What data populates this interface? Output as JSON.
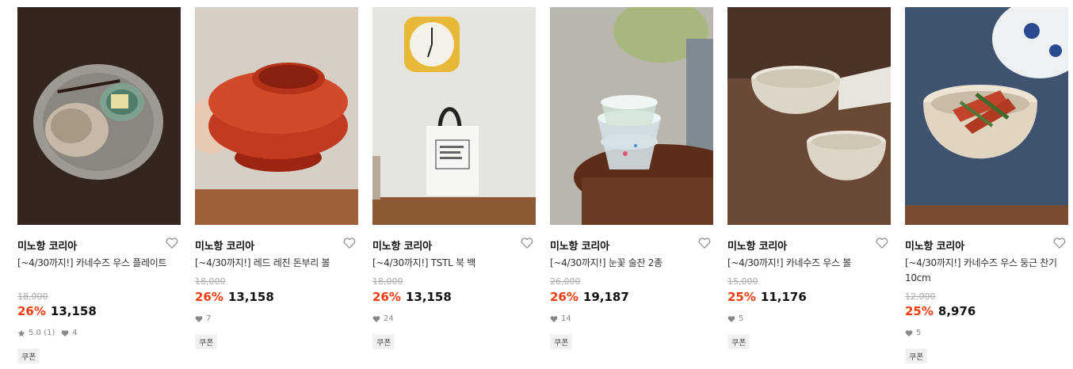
{
  "coupon_label": "쿠폰",
  "products": [
    {
      "brand": "미노항 코리아",
      "title": "[~4/30까지!] 카네수즈 우스 플레이트",
      "original_price": "18,000",
      "discount": "26%",
      "price": "13,158",
      "rating": "5.0 (1)",
      "likes": "4",
      "image": "plate-with-bread",
      "heart_icon": "heart-outline-icon"
    },
    {
      "brand": "미노항 코리아",
      "title": "[~4/30까지!] 레드 레진 돈부리 볼",
      "original_price": "18,000",
      "discount": "26%",
      "price": "13,158",
      "likes": "7",
      "image": "red-lacquer-bowl",
      "heart_icon": "heart-outline-icon"
    },
    {
      "brand": "미노항 코리아",
      "title": "[~4/30까지!] TSTL 북 백",
      "original_price": "18,000",
      "discount": "26%",
      "price": "13,158",
      "likes": "24",
      "image": "tote-bag-with-clock",
      "heart_icon": "heart-outline-icon"
    },
    {
      "brand": "미노항 코리아",
      "title": "[~4/30까지!] 눈꽃 술잔 2종",
      "original_price": "26,000",
      "discount": "26%",
      "price": "19,187",
      "likes": "14",
      "image": "glass-cups",
      "heart_icon": "heart-outline-icon"
    },
    {
      "brand": "미노항 코리아",
      "title": "[~4/30까지!] 카네수즈 우스 볼",
      "original_price": "15,000",
      "discount": "25%",
      "price": "11,176",
      "likes": "5",
      "image": "speckled-bowls",
      "heart_icon": "heart-outline-icon"
    },
    {
      "brand": "미노항 코리아",
      "title": "[~4/30까지!] 카네수즈 우스 둥근 찬기 10cm",
      "original_price": "12,000",
      "discount": "25%",
      "price": "8,976",
      "likes": "5",
      "image": "kimchi-bowl",
      "heart_icon": "heart-outline-icon"
    }
  ],
  "colors": {
    "discount": "#f23b0d",
    "strike": "#aaaaaa",
    "coupon_bg": "#f1f1f1"
  }
}
